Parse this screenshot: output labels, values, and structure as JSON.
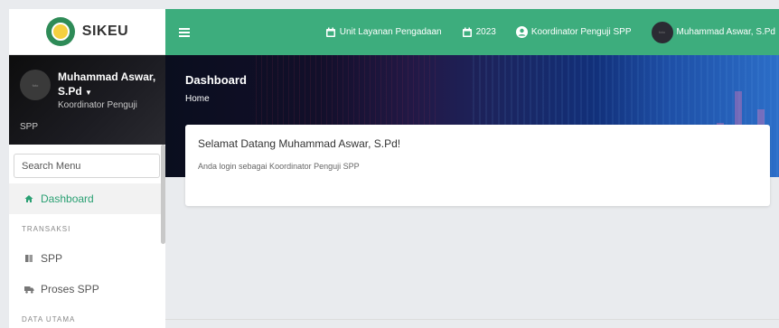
{
  "brand": {
    "name": "SIKEU"
  },
  "user_panel": {
    "avatar_text": "foto",
    "name": "Muhammad Aswar, S.Pd",
    "role_line1": "Koordinator Penguji",
    "role_line2": "SPP"
  },
  "search": {
    "placeholder": "Search Menu"
  },
  "menu": {
    "dashboard": "Dashboard",
    "header_transaksi": "TRANSAKSI",
    "spp": "SPP",
    "proses_spp": "Proses SPP",
    "header_data_utama": "DATA UTAMA"
  },
  "topbar": {
    "unit": "Unit Layanan Pengadaan",
    "year": "2023",
    "role": "Koordinator Penguji SPP",
    "user": "Muhammad Aswar, S.Pd"
  },
  "banner": {
    "title": "Dashboard",
    "breadcrumb": "Home"
  },
  "card": {
    "title": "Selamat Datang Muhammad Aswar, S.Pd!",
    "text": "Anda login sebagai Koordinator Penguji SPP"
  },
  "colors": {
    "primary": "#3dad7d",
    "active_text": "#2aa073"
  }
}
